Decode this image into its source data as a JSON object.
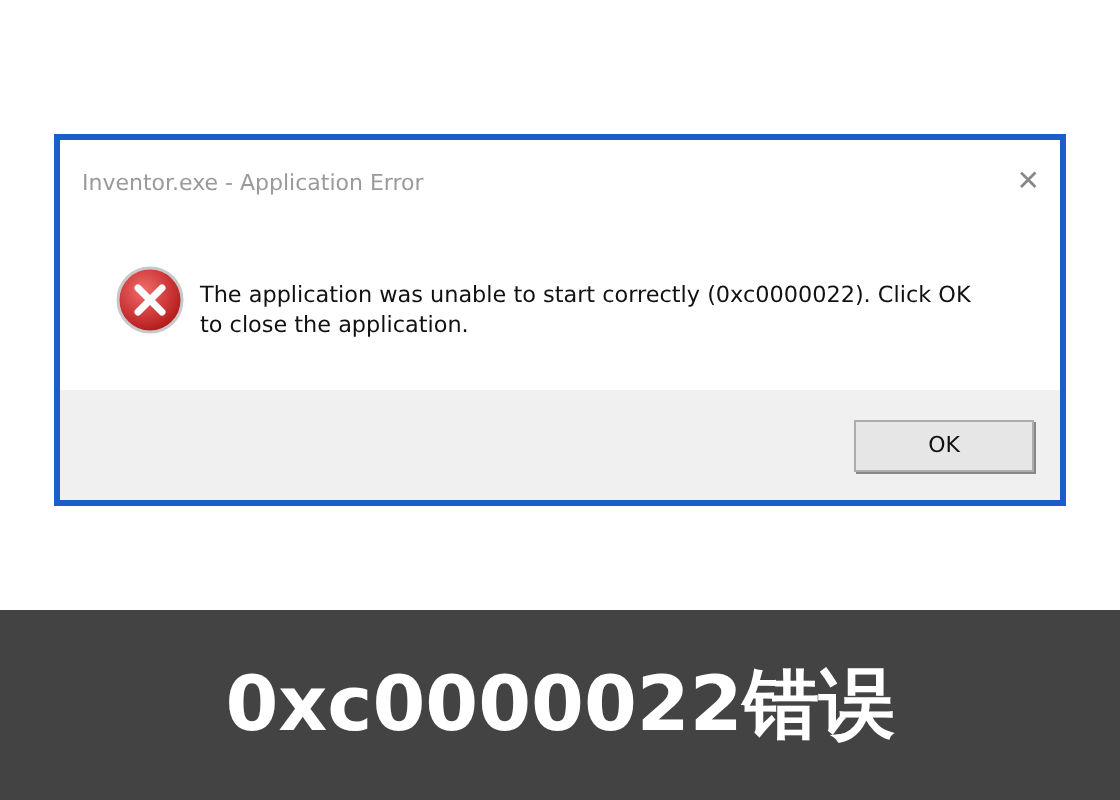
{
  "dialog": {
    "title": "Inventor.exe - Application Error",
    "close": "✕",
    "message": "The application was unable to start correctly (0xc0000022). Click OK to close the application.",
    "buttons": [
      "OK"
    ]
  },
  "banner": {
    "text": "0xc0000022错误"
  }
}
